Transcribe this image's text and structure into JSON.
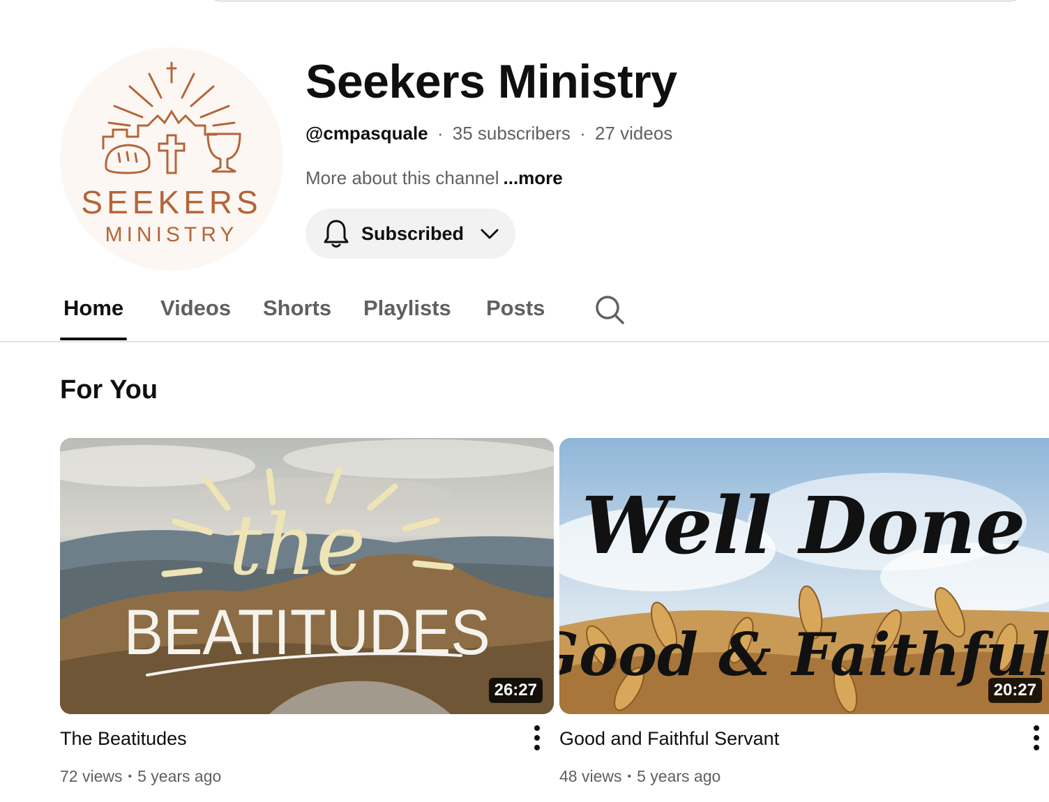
{
  "channel": {
    "name": "Seekers Ministry",
    "handle": "@cmpasquale",
    "subscribers": "35 subscribers",
    "videos": "27 videos",
    "about": "More about this channel",
    "more_link": "...more",
    "subscribe_label": "Subscribed",
    "avatar_text_line1": "SEEKERS",
    "avatar_text_line2": "MINISTRY"
  },
  "tabs": [
    {
      "label": "Home",
      "active": true
    },
    {
      "label": "Videos",
      "active": false
    },
    {
      "label": "Shorts",
      "active": false
    },
    {
      "label": "Playlists",
      "active": false
    },
    {
      "label": "Posts",
      "active": false
    }
  ],
  "section": {
    "title": "For You"
  },
  "videos": [
    {
      "title": "The Beatitudes",
      "views": "72 views",
      "age": "5 years ago",
      "duration": "26:27",
      "thumb_text_top": "the",
      "thumb_text_bottom": "BEATITUDES"
    },
    {
      "title": "Good and Faithful Servant",
      "views": "48 views",
      "age": "5 years ago",
      "duration": "20:27",
      "thumb_text_top": "Well Done",
      "thumb_text_bottom": "Good & Faithful"
    }
  ],
  "colors": {
    "brand_logo": "#b5643a",
    "text_primary": "#0f0f0f",
    "text_secondary": "#606060",
    "button_bg": "#f2f2f2"
  },
  "icons": [
    "bell-icon",
    "chevron-down-icon",
    "search-icon",
    "more-vert-icon"
  ]
}
